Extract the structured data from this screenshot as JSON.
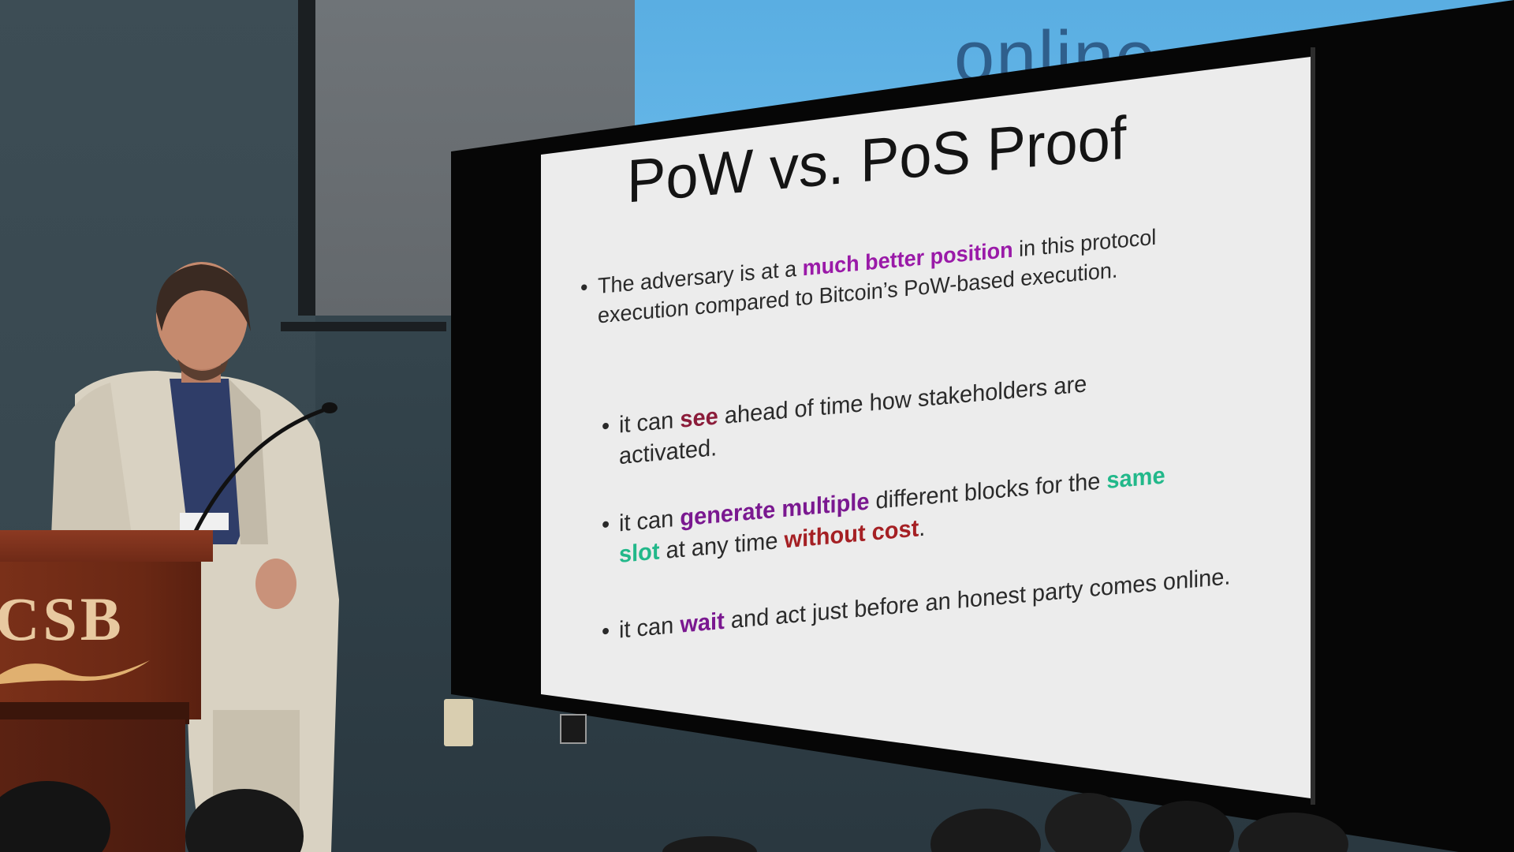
{
  "background_screen": {
    "text": "online"
  },
  "slide": {
    "title": "PoW vs. PoS Proof",
    "bullet_marker": "•",
    "bullet1": {
      "pre": "The adversary is at a ",
      "highlight": "much better position",
      "post": " in this protocol execution compared to Bitcoin’s PoW-based execution."
    },
    "bullet2": {
      "pre": "it can ",
      "highlight": "see",
      "post": " ahead of time how stakeholders are activated."
    },
    "bullet3": {
      "pre": "it can ",
      "highlight1": "generate multiple",
      "mid1": " different blocks for the ",
      "highlight2": "same slot",
      "mid2": " at any time ",
      "highlight3": "without cost",
      "post": "."
    },
    "bullet4": {
      "pre": "it can ",
      "highlight": "wait",
      "post": " and act just before an honest party comes online."
    },
    "colors": {
      "highlight_purple": "#9a1aa8",
      "highlight_darkred": "#8b1c3a",
      "highlight_violet": "#7a1890",
      "highlight_teal": "#22b88a",
      "highlight_brick": "#a52024"
    }
  },
  "podium": {
    "logo_text": "CSB"
  }
}
